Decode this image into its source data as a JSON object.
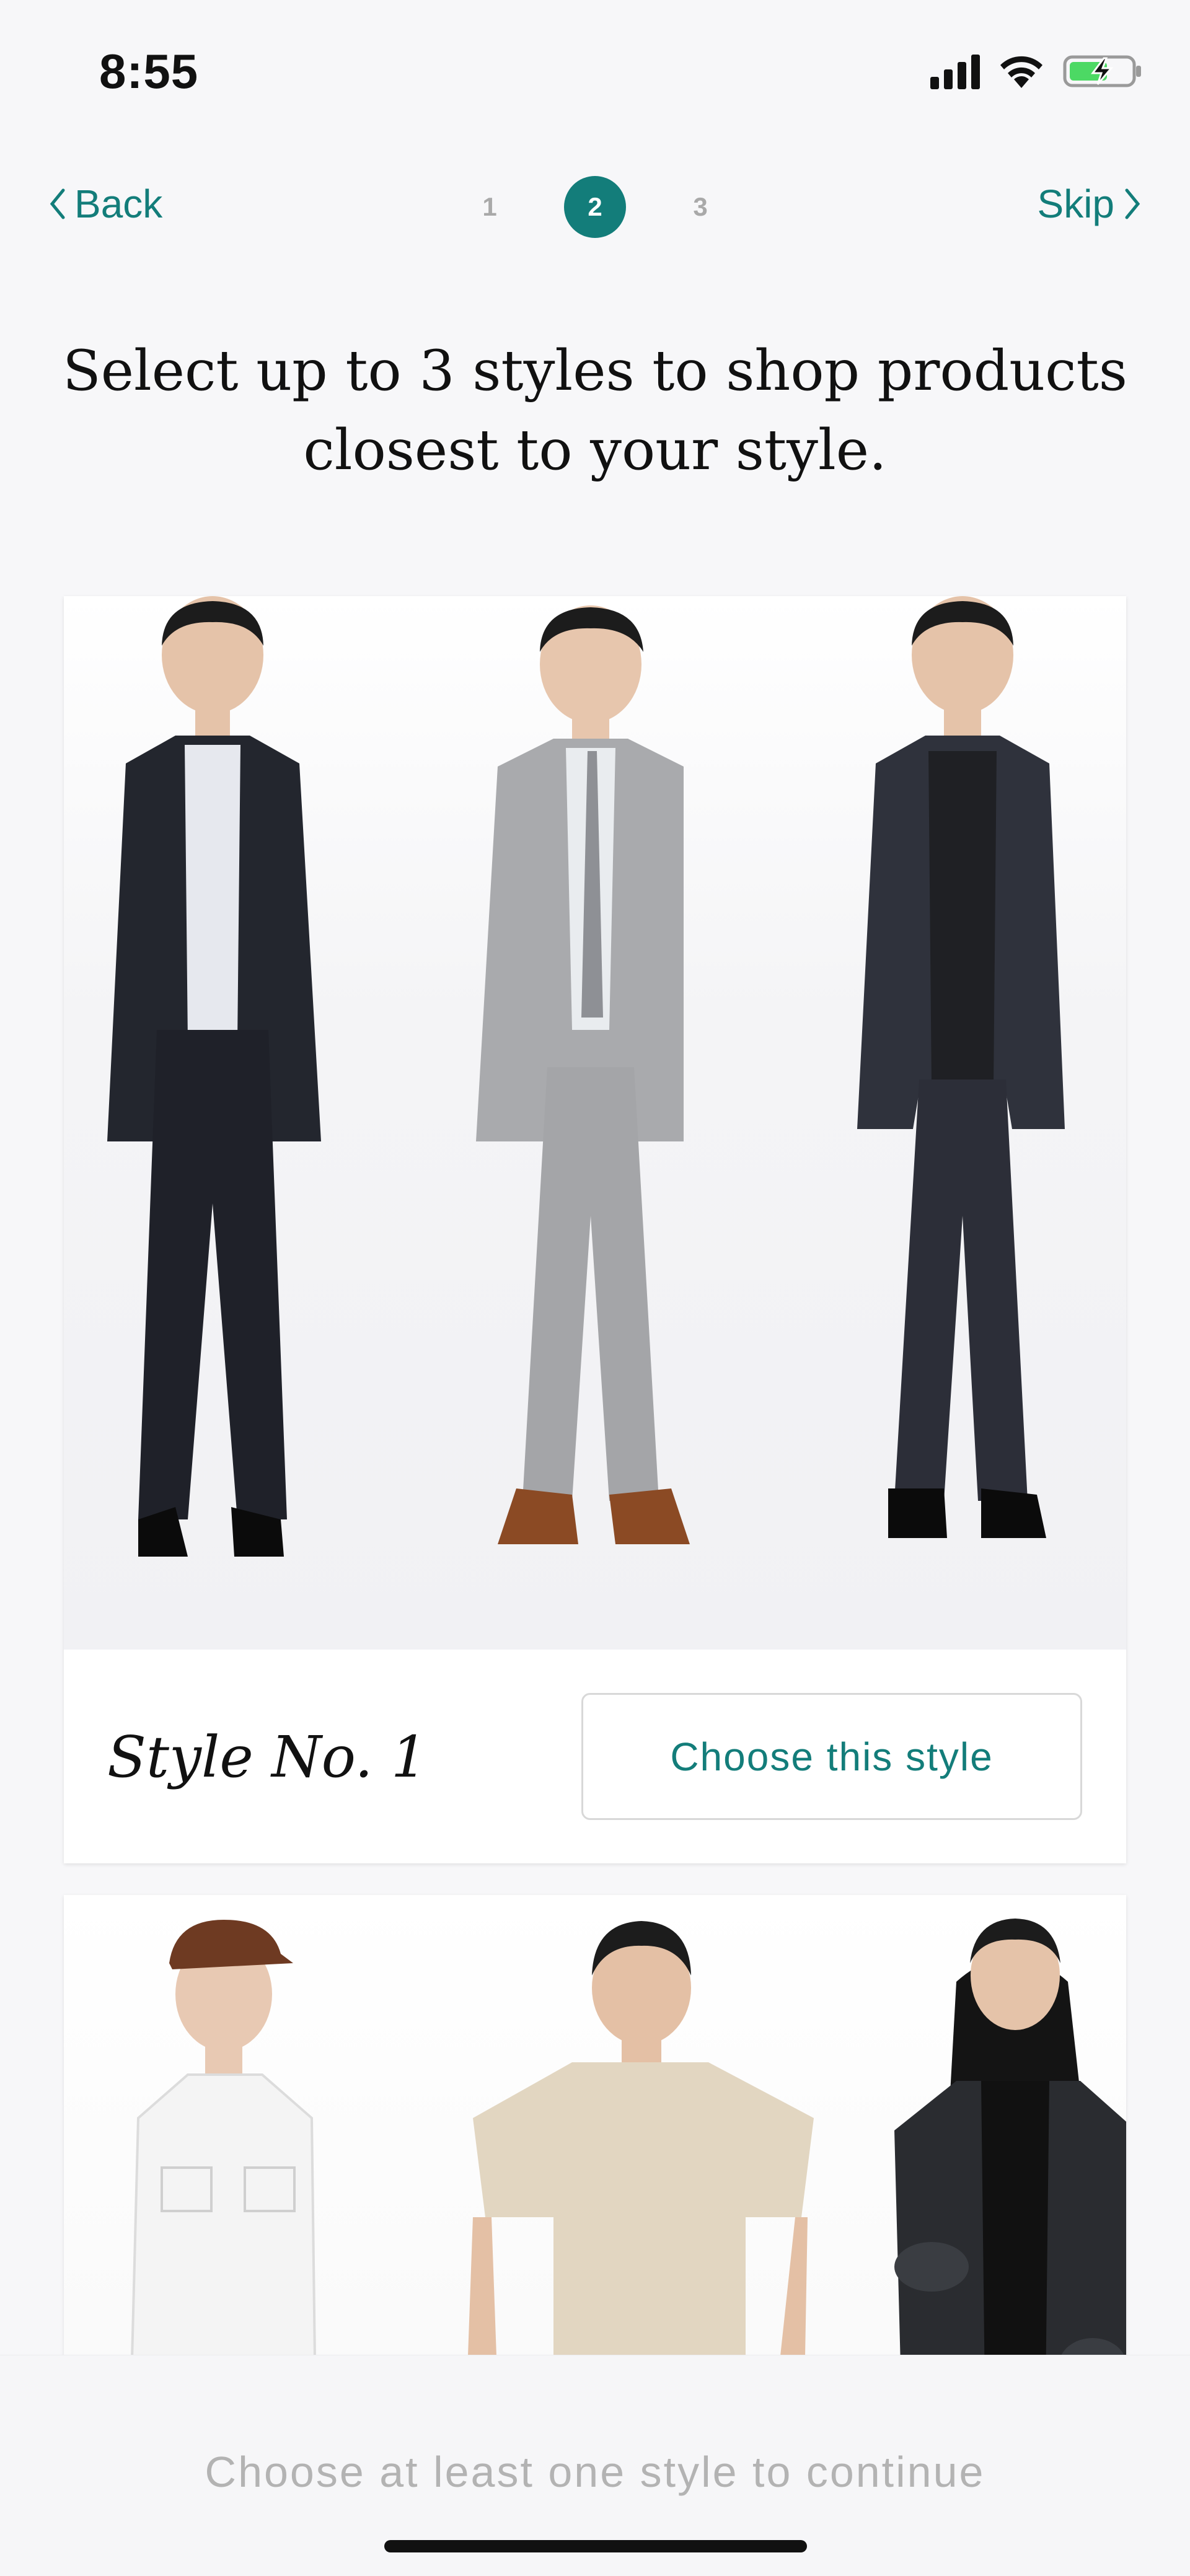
{
  "status_bar": {
    "time": "8:55",
    "icons": [
      "signal-icon",
      "wifi-icon",
      "battery-charging-icon"
    ]
  },
  "nav": {
    "back_label": "Back",
    "skip_label": "Skip",
    "steps": [
      "1",
      "2",
      "3"
    ],
    "active_step": "2"
  },
  "heading": "Select up to 3 styles to shop products closest to your style.",
  "styles": [
    {
      "label": "Style No. 1",
      "button_label": "Choose this style",
      "looks": [
        "dark suit with band-collar shirt",
        "light grey suit with monk-strap shoes",
        "plaid blazer with dark jeans"
      ]
    },
    {
      "label": "",
      "button_label": "",
      "looks": [
        "white denim shirt with brown cap",
        "beige t-shirt",
        "black camo bomber jacket with hoodie"
      ]
    }
  ],
  "footer": {
    "continue_text": "Choose at least one style to continue"
  },
  "colors": {
    "accent": "#137d7a",
    "background": "#f7f7f9",
    "disabled_text": "#b3b3b3"
  }
}
